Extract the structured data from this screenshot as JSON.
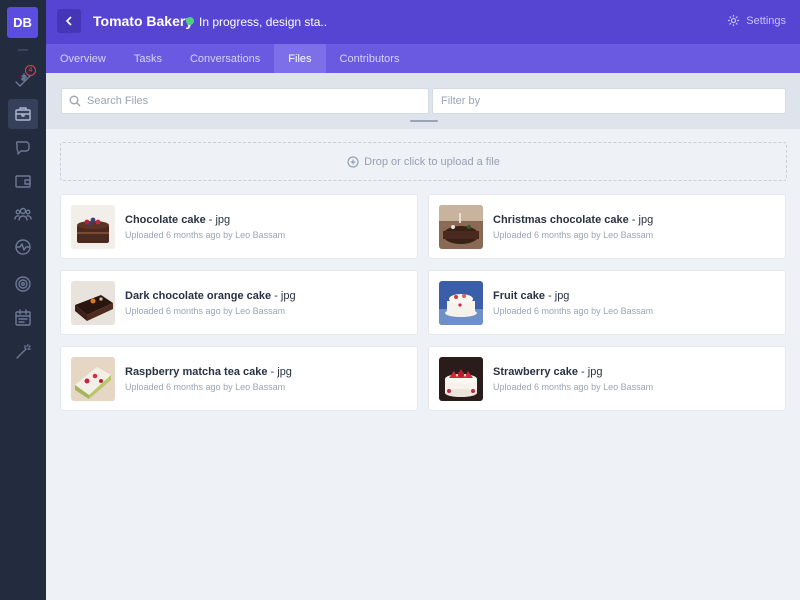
{
  "rail": {
    "avatar_initials": "DB",
    "notification_count": "4",
    "items": [
      {
        "icon": "check-dollar-icon"
      },
      {
        "icon": "briefcase-icon"
      },
      {
        "icon": "chat-icon"
      },
      {
        "icon": "wallet-icon"
      },
      {
        "icon": "team-icon"
      },
      {
        "icon": "activity-icon"
      },
      {
        "icon": "target-icon"
      },
      {
        "icon": "calendar-icon"
      },
      {
        "icon": "magic-wand-icon"
      }
    ]
  },
  "header": {
    "title": "Tomato Bakery",
    "status_color": "#4cd27b",
    "status": "In progress, design sta..",
    "settings_label": "Settings"
  },
  "tabs": [
    {
      "label": "Overview",
      "active": false
    },
    {
      "label": "Tasks",
      "active": false
    },
    {
      "label": "Conversations",
      "active": false
    },
    {
      "label": "Files",
      "active": true
    },
    {
      "label": "Contributors",
      "active": false
    }
  ],
  "search": {
    "placeholder": "Search Files",
    "filter_placeholder": "Filter by"
  },
  "upload": {
    "label": "Drop or click to upload a file"
  },
  "files": [
    {
      "name": "Chocolate cake",
      "ext": " - jpg",
      "meta": "Uploaded 6 months ago by Leo Bassam"
    },
    {
      "name": "Christmas chocolate cake",
      "ext": " - jpg",
      "meta": "Uploaded 6 months ago by Leo Bassam"
    },
    {
      "name": "Dark chocolate orange cake",
      "ext": " - jpg",
      "meta": "Uploaded 6 months ago by Leo Bassam"
    },
    {
      "name": "Fruit cake",
      "ext": " - jpg",
      "meta": "Uploaded 6 months ago by Leo Bassam"
    },
    {
      "name": "Raspberry matcha tea cake",
      "ext": " - jpg",
      "meta": "Uploaded 6 months ago by Leo Bassam"
    },
    {
      "name": "Strawberry cake",
      "ext": " - jpg",
      "meta": "Uploaded 6 months ago by Leo Bassam"
    }
  ],
  "colors": {
    "header": "#5644d3",
    "tabs": "#6a5ae2",
    "rail": "#232b3f"
  }
}
